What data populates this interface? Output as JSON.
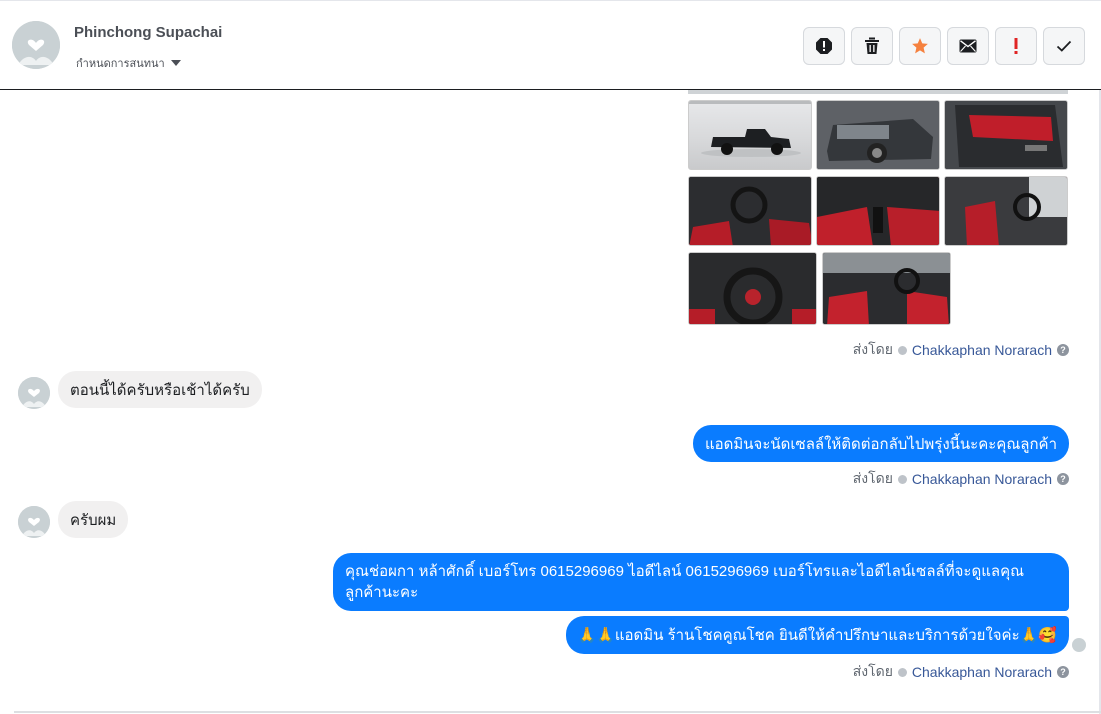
{
  "header": {
    "contact_name": "Phinchong Supachai",
    "assign_label": "กำหนดการสนทนา",
    "actions": [
      {
        "name": "report-icon",
        "color": "#1c1e21"
      },
      {
        "name": "trash-icon",
        "color": "#1c1e21"
      },
      {
        "name": "star-icon",
        "color": "#f5813f"
      },
      {
        "name": "mail-icon",
        "color": "#1c1e21"
      },
      {
        "name": "exclamation-icon",
        "color": "#e02424"
      },
      {
        "name": "check-icon",
        "color": "#1c1e21"
      }
    ]
  },
  "messages": {
    "sent_by_prefix": "ส่งโดย",
    "sent_by_name": "Chakkaphan Norarach",
    "help_glyph": "?",
    "incoming_1": "ตอนนี้ได้ครับหรือเช้าได้ครับ",
    "outgoing_1": "แอดมินจะนัดเซลล์ให้ติดต่อกลับไปพรุ่งนี้นะคะคุณลูกค้า",
    "incoming_2": "ครับผม",
    "outgoing_2": "คุณช่อผกา หล้าศักดิ์      เบอร์โทร 0615296969  ไอดีไลน์ 0615296969   เบอร์โทรและไอดีไลน์เซลล์ที่จะดูแลคุณลูกค้านะคะ",
    "outgoing_3": "🙏🙏แอดมิน ร้านโชคคูณโชค ยินดีให้คำปรึกษาและบริการด้วยใจค่ะ🙏🥰"
  },
  "colors": {
    "outgoing_bubble": "#0a7cff",
    "incoming_bubble": "#f1f0f0",
    "sent_by_name": "#385898"
  }
}
